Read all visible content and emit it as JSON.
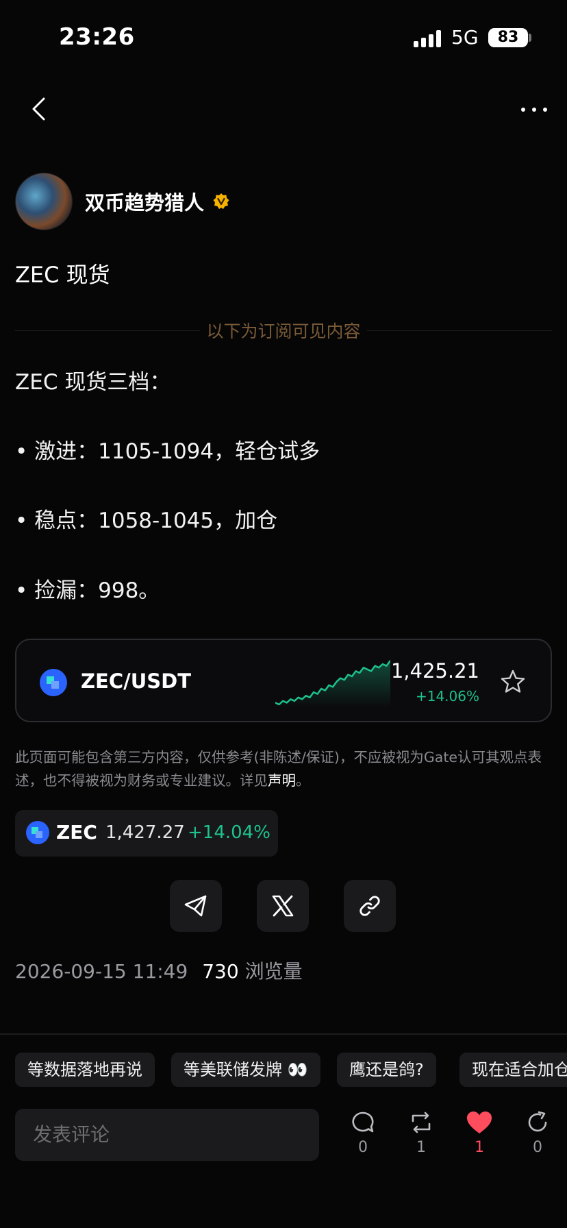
{
  "status_bar": {
    "time": "23:26",
    "network": "5G",
    "battery": "83"
  },
  "author": {
    "name": "双币趋势猎人"
  },
  "post": {
    "title": "ZEC 现货",
    "subscription_divider": "以下为订阅可见内容",
    "lines": [
      "ZEC 现货三档：",
      "• 激进：1105-1094，轻仓试多",
      "• 稳点：1058-1045，加仓",
      "• 捡漏：998。"
    ]
  },
  "market_card": {
    "pair": "ZEC/USDT",
    "price": "1,425.21",
    "change": "+14.06%",
    "sparkline": [
      2,
      1,
      3,
      2,
      4,
      3,
      5,
      4,
      6,
      5,
      8,
      7,
      10,
      9,
      12,
      11,
      14,
      16,
      15,
      18,
      17,
      20,
      19,
      22,
      21,
      20,
      23,
      22,
      24,
      23,
      26
    ],
    "accent_color": "#1ec28b"
  },
  "disclaimer": {
    "text": "此页面可能包含第三方内容，仅供参考(非陈述/保证)，不应被视为Gate认可其观点表述，也不得被视为财务或专业建议。详见",
    "link": "声明",
    "end": "。"
  },
  "ticker": {
    "symbol": "ZEC",
    "price": "1,427.27",
    "change": "+14.04%"
  },
  "share": {
    "icons": [
      "telegram-icon",
      "x-icon",
      "link-icon"
    ]
  },
  "meta": {
    "datetime": "2026-09-15 11:49",
    "views": "730",
    "views_label": "浏览量"
  },
  "quick_replies": [
    "等数据落地再说",
    "等美联储发牌 👀",
    "鹰还是鸽?",
    "现在适合加仓"
  ],
  "comment_box": {
    "placeholder": "发表评论"
  },
  "actions": {
    "comments": "0",
    "reposts": "1",
    "likes": "1",
    "shares": "0"
  },
  "colors": {
    "positive": "#1ec28b",
    "like": "#ff4d5e",
    "divider_text": "#7a5a36",
    "verified": "#f5b300"
  }
}
